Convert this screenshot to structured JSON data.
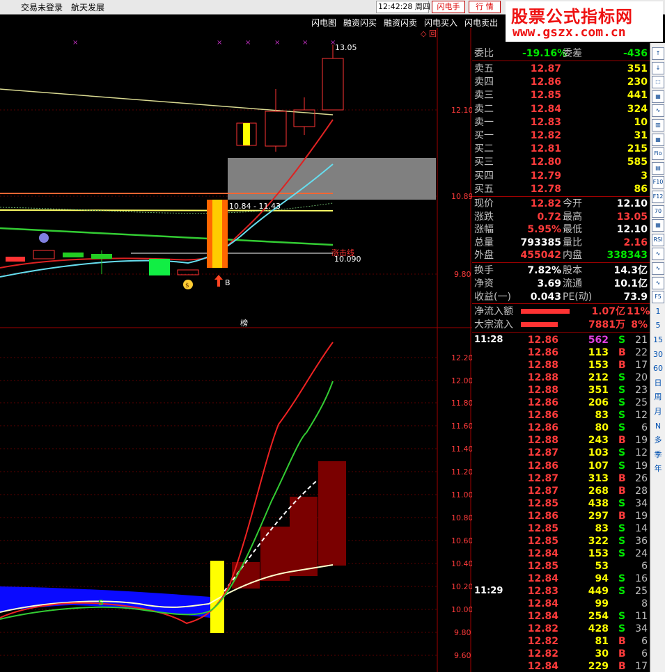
{
  "topbar": {
    "login_status": "交易未登录",
    "stock_name": "航天发展",
    "clock": "12:42:28 周四",
    "btn_flash": "闪电手",
    "btn_quote": "行 情"
  },
  "watermark": {
    "line1": "股票公式指标网",
    "line2": "www.gszx.com.cn"
  },
  "flash_menu": [
    "闪电图",
    "融资闪买",
    "融资闪卖",
    "闪电买入",
    "闪电卖出"
  ],
  "upper_chart": {
    "price_labels": [
      "12.10",
      "10.89",
      "9.80"
    ],
    "high_label": "13.05",
    "range_label": "10.84 - 11.43",
    "line_label": "涨击线",
    "line_value": "10.090",
    "buy_marker": "B",
    "rank_label": "榜",
    "corner_mark": "◇ 回"
  },
  "lower_chart": {
    "price_labels": [
      "12.20",
      "12.00",
      "11.80",
      "11.60",
      "11.40",
      "11.20",
      "11.00",
      "10.80",
      "10.60",
      "10.40",
      "10.20",
      "10.00",
      "9.80",
      "9.60"
    ],
    "sell_marker": "S"
  },
  "order_book": {
    "weibi_label": "委比",
    "weibi_value": "-19.16%",
    "weicha_label": "委差",
    "weicha_value": "-436",
    "asks": [
      {
        "label": "卖五",
        "price": "12.87",
        "vol": "351"
      },
      {
        "label": "卖四",
        "price": "12.86",
        "vol": "230"
      },
      {
        "label": "卖三",
        "price": "12.85",
        "vol": "441"
      },
      {
        "label": "卖二",
        "price": "12.84",
        "vol": "324"
      },
      {
        "label": "卖一",
        "price": "12.83",
        "vol": "10"
      }
    ],
    "bids": [
      {
        "label": "买一",
        "price": "12.82",
        "vol": "31"
      },
      {
        "label": "买二",
        "price": "12.81",
        "vol": "215"
      },
      {
        "label": "买三",
        "price": "12.80",
        "vol": "585"
      },
      {
        "label": "买四",
        "price": "12.79",
        "vol": "3"
      },
      {
        "label": "买五",
        "price": "12.78",
        "vol": "86"
      }
    ]
  },
  "quote": [
    {
      "l1": "现价",
      "v1": "12.82",
      "c1": "red",
      "l2": "今开",
      "v2": "12.10",
      "c2": "wht"
    },
    {
      "l1": "涨跌",
      "v1": "0.72",
      "c1": "red",
      "l2": "最高",
      "v2": "13.05",
      "c2": "red"
    },
    {
      "l1": "涨幅",
      "v1": "5.95%",
      "c1": "red",
      "l2": "最低",
      "v2": "12.10",
      "c2": "wht"
    },
    {
      "l1": "总量",
      "v1": "793385",
      "c1": "wht",
      "l2": "量比",
      "v2": "2.16",
      "c2": "red"
    },
    {
      "l1": "外盘",
      "v1": "455042",
      "c1": "red",
      "l2": "内盘",
      "v2": "338343",
      "c2": "grn"
    }
  ],
  "fundamentals": [
    {
      "l1": "换手",
      "v1": "7.82%",
      "l2": "股本",
      "v2": "14.3亿"
    },
    {
      "l1": "净资",
      "v1": "3.69",
      "l2": "流通",
      "v2": "10.1亿"
    },
    {
      "l1": "收益(一)",
      "v1": "0.043",
      "l2": "PE(动)",
      "v2": "73.9"
    }
  ],
  "flows": [
    {
      "label": "净流入额",
      "value": "1.07亿",
      "pct": "11%",
      "bar": 0.58
    },
    {
      "label": "大宗流入",
      "value": "7881万",
      "pct": "8%",
      "bar": 0.44
    }
  ],
  "trades": [
    {
      "time": "11:28",
      "price": "12.86",
      "vol": "562",
      "vc": "mag",
      "bs": "S",
      "cnt": "21"
    },
    {
      "time": "",
      "price": "12.86",
      "vol": "113",
      "vc": "yel",
      "bs": "B",
      "cnt": "22"
    },
    {
      "time": "",
      "price": "12.88",
      "vol": "153",
      "vc": "yel",
      "bs": "B",
      "cnt": "17"
    },
    {
      "time": "",
      "price": "12.88",
      "vol": "212",
      "vc": "yel",
      "bs": "S",
      "cnt": "20"
    },
    {
      "time": "",
      "price": "12.88",
      "vol": "351",
      "vc": "yel",
      "bs": "S",
      "cnt": "23"
    },
    {
      "time": "",
      "price": "12.86",
      "vol": "206",
      "vc": "yel",
      "bs": "S",
      "cnt": "25"
    },
    {
      "time": "",
      "price": "12.86",
      "vol": "83",
      "vc": "yel",
      "bs": "S",
      "cnt": "12"
    },
    {
      "time": "",
      "price": "12.86",
      "vol": "80",
      "vc": "yel",
      "bs": "S",
      "cnt": "6"
    },
    {
      "time": "",
      "price": "12.88",
      "vol": "243",
      "vc": "yel",
      "bs": "B",
      "cnt": "19"
    },
    {
      "time": "",
      "price": "12.87",
      "vol": "103",
      "vc": "yel",
      "bs": "S",
      "cnt": "12"
    },
    {
      "time": "",
      "price": "12.86",
      "vol": "107",
      "vc": "yel",
      "bs": "S",
      "cnt": "19"
    },
    {
      "time": "",
      "price": "12.87",
      "vol": "313",
      "vc": "yel",
      "bs": "B",
      "cnt": "26"
    },
    {
      "time": "",
      "price": "12.87",
      "vol": "268",
      "vc": "yel",
      "bs": "B",
      "cnt": "28"
    },
    {
      "time": "",
      "price": "12.85",
      "vol": "438",
      "vc": "yel",
      "bs": "S",
      "cnt": "34"
    },
    {
      "time": "",
      "price": "12.86",
      "vol": "297",
      "vc": "yel",
      "bs": "B",
      "cnt": "19"
    },
    {
      "time": "",
      "price": "12.85",
      "vol": "83",
      "vc": "yel",
      "bs": "S",
      "cnt": "14"
    },
    {
      "time": "",
      "price": "12.85",
      "vol": "322",
      "vc": "yel",
      "bs": "S",
      "cnt": "36"
    },
    {
      "time": "",
      "price": "12.84",
      "vol": "153",
      "vc": "yel",
      "bs": "S",
      "cnt": "24"
    },
    {
      "time": "",
      "price": "12.85",
      "vol": "53",
      "vc": "yel",
      "bs": "",
      "cnt": "6"
    },
    {
      "time": "",
      "price": "12.84",
      "vol": "94",
      "vc": "yel",
      "bs": "S",
      "cnt": "16"
    },
    {
      "time": "11:29",
      "price": "12.83",
      "vol": "449",
      "vc": "yel",
      "bs": "S",
      "cnt": "25"
    },
    {
      "time": "",
      "price": "12.84",
      "vol": "99",
      "vc": "yel",
      "bs": "",
      "cnt": "8"
    },
    {
      "time": "",
      "price": "12.84",
      "vol": "254",
      "vc": "yel",
      "bs": "S",
      "cnt": "11"
    },
    {
      "time": "",
      "price": "12.82",
      "vol": "428",
      "vc": "yel",
      "bs": "S",
      "cnt": "34"
    },
    {
      "time": "",
      "price": "12.82",
      "vol": "81",
      "vc": "yel",
      "bs": "B",
      "cnt": "6"
    },
    {
      "time": "",
      "price": "12.82",
      "vol": "30",
      "vc": "yel",
      "bs": "B",
      "cnt": "6"
    },
    {
      "time": "",
      "price": "12.84",
      "vol": "229",
      "vc": "yel",
      "bs": "B",
      "cnt": "17"
    }
  ],
  "sidebar": [
    "↑",
    "↓",
    "⬚",
    "▦",
    "∿",
    "▥",
    "▦",
    "Fio",
    "▤",
    "F10",
    "F12",
    "70",
    "▦",
    "RSI",
    "∿",
    "∿",
    "∿",
    "F5",
    "1",
    "5",
    "15",
    "30",
    "60",
    "日",
    "周",
    "月",
    "N",
    "多",
    "季",
    "年"
  ]
}
